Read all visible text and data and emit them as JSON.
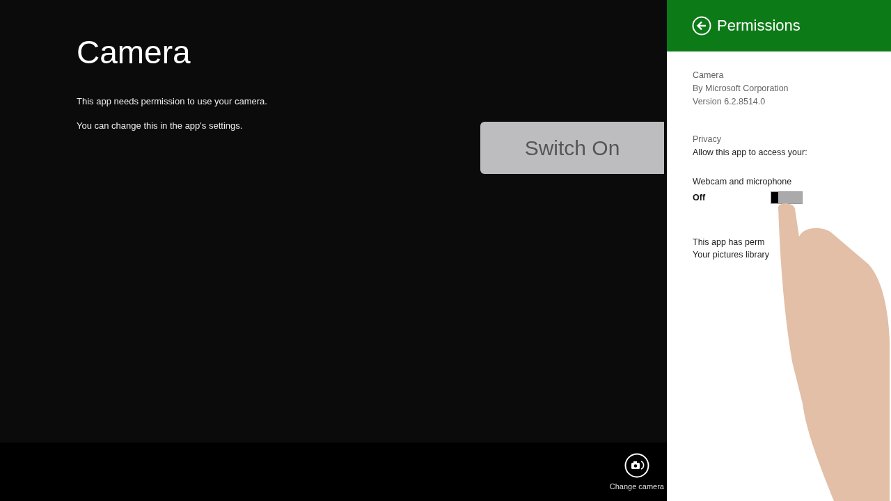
{
  "app": {
    "title": "Camera",
    "messages": [
      "This app needs permission to use your camera.",
      "You can change this in the app's settings."
    ]
  },
  "app_bar": {
    "buttons": [
      {
        "label": "Change camera"
      }
    ]
  },
  "callout": {
    "text": "Switch On"
  },
  "permissions_pane": {
    "title": "Permissions",
    "app_info": [
      "Camera",
      "By Microsoft Corporation",
      "Version 6.2.8514.0"
    ],
    "privacy": {
      "heading": "Privacy",
      "subheading": "Allow this app to access your:"
    },
    "settings": [
      {
        "label": "Webcam and microphone",
        "state_text": "Off",
        "on": false
      }
    ],
    "notes": [
      "This app has perm",
      "Your pictures library"
    ]
  }
}
